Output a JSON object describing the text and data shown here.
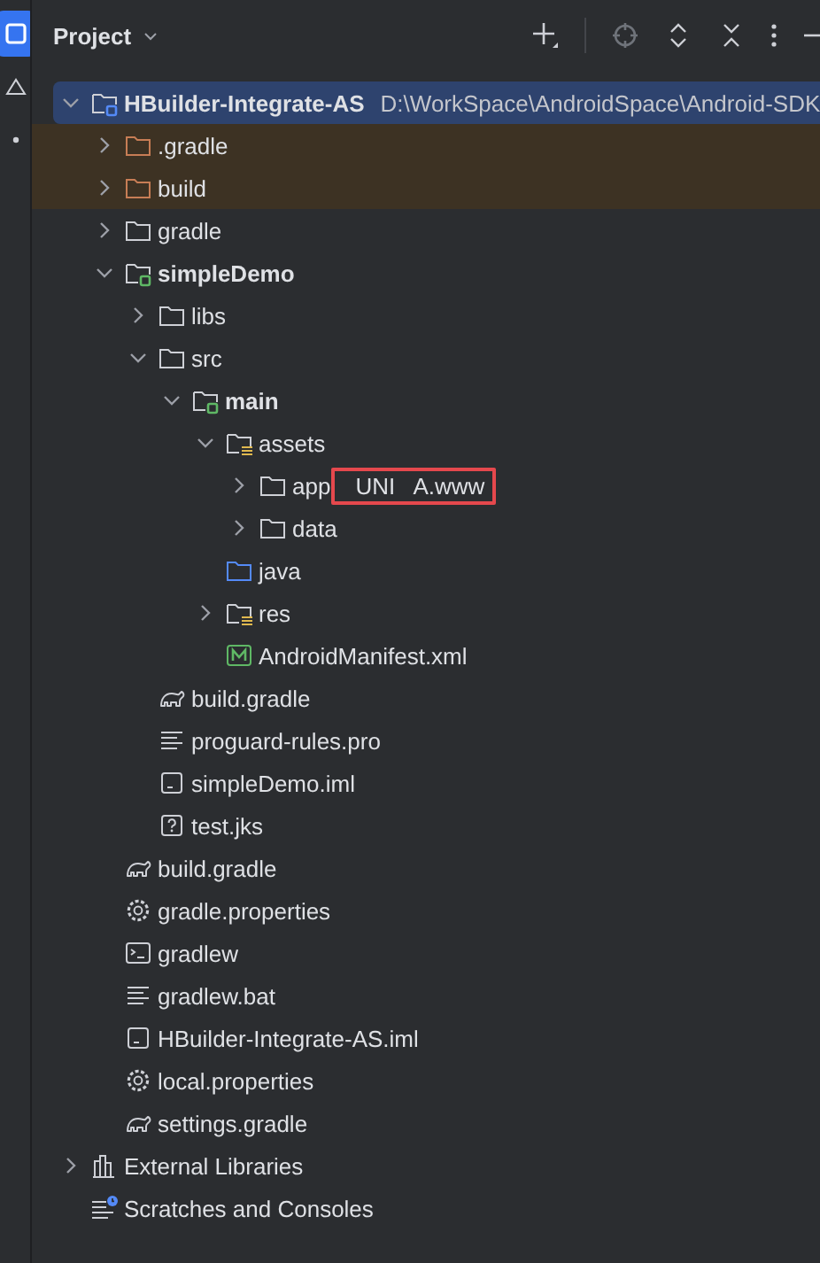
{
  "tool_strip": [
    {
      "selected": true
    },
    {
      "selected": false
    },
    {
      "selected": false
    }
  ],
  "panel": {
    "title": "Project"
  },
  "tree": [
    {
      "name": "HBuilder-Integrate-AS",
      "path": "D:\\WorkSpace\\AndroidSpace\\Android-SDK",
      "kind": "project",
      "selected": true,
      "excluded": false,
      "expanded": true,
      "children": [
        {
          "name": ".gradle",
          "kind": "folder",
          "selected": false,
          "excluded": true,
          "expanded": false
        },
        {
          "name": "build",
          "kind": "folder",
          "selected": false,
          "excluded": true,
          "expanded": false
        },
        {
          "name": "gradle",
          "kind": "folder",
          "selected": false,
          "excluded": false,
          "expanded": false
        },
        {
          "name": "simpleDemo",
          "kind": "module",
          "selected": false,
          "excluded": false,
          "expanded": true,
          "children": [
            {
              "name": "libs",
              "kind": "folder",
              "selected": false,
              "excluded": false,
              "expanded": false
            },
            {
              "name": "src",
              "kind": "folder",
              "selected": false,
              "excluded": false,
              "expanded": true,
              "children": [
                {
                  "name": "main",
                  "kind": "sourceset",
                  "selected": false,
                  "excluded": false,
                  "expanded": true,
                  "children": [
                    {
                      "name": "assets",
                      "kind": "resources",
                      "selected": false,
                      "excluded": false,
                      "expanded": true,
                      "children": [
                        {
                          "name": "app",
                          "annotation": "UNI   A.www",
                          "kind": "folder",
                          "selected": false,
                          "excluded": false,
                          "expanded": false
                        },
                        {
                          "name": "data",
                          "kind": "folder",
                          "selected": false,
                          "excluded": false,
                          "expanded": false
                        }
                      ]
                    },
                    {
                      "name": "java",
                      "kind": "java",
                      "selected": false,
                      "excluded": false
                    },
                    {
                      "name": "res",
                      "kind": "resources",
                      "selected": false,
                      "excluded": false,
                      "expanded": false
                    },
                    {
                      "name": "AndroidManifest.xml",
                      "kind": "manifest",
                      "selected": false,
                      "excluded": false
                    }
                  ]
                }
              ]
            },
            {
              "name": "build.gradle",
              "kind": "gradle",
              "selected": false,
              "excluded": false
            },
            {
              "name": "proguard-rules.pro",
              "kind": "text",
              "selected": false,
              "excluded": false
            },
            {
              "name": "simpleDemo.iml",
              "kind": "iml",
              "selected": false,
              "excluded": false
            },
            {
              "name": "test.jks",
              "kind": "unknown",
              "selected": false,
              "excluded": false
            }
          ]
        },
        {
          "name": "build.gradle",
          "kind": "gradle",
          "selected": false,
          "excluded": false
        },
        {
          "name": "gradle.properties",
          "kind": "settings",
          "selected": false,
          "excluded": false
        },
        {
          "name": "gradlew",
          "kind": "terminal",
          "selected": false,
          "excluded": false
        },
        {
          "name": "gradlew.bat",
          "kind": "text",
          "selected": false,
          "excluded": false
        },
        {
          "name": "HBuilder-Integrate-AS.iml",
          "kind": "iml",
          "selected": false,
          "excluded": false
        },
        {
          "name": "local.properties",
          "kind": "settings",
          "selected": false,
          "excluded": false
        },
        {
          "name": "settings.gradle",
          "kind": "gradle",
          "selected": false,
          "excluded": false
        }
      ]
    },
    {
      "name": "External Libraries",
      "kind": "libraries",
      "selected": false,
      "excluded": false,
      "expanded": false
    },
    {
      "name": "Scratches and Consoles",
      "kind": "scratches",
      "selected": false,
      "excluded": false
    }
  ]
}
